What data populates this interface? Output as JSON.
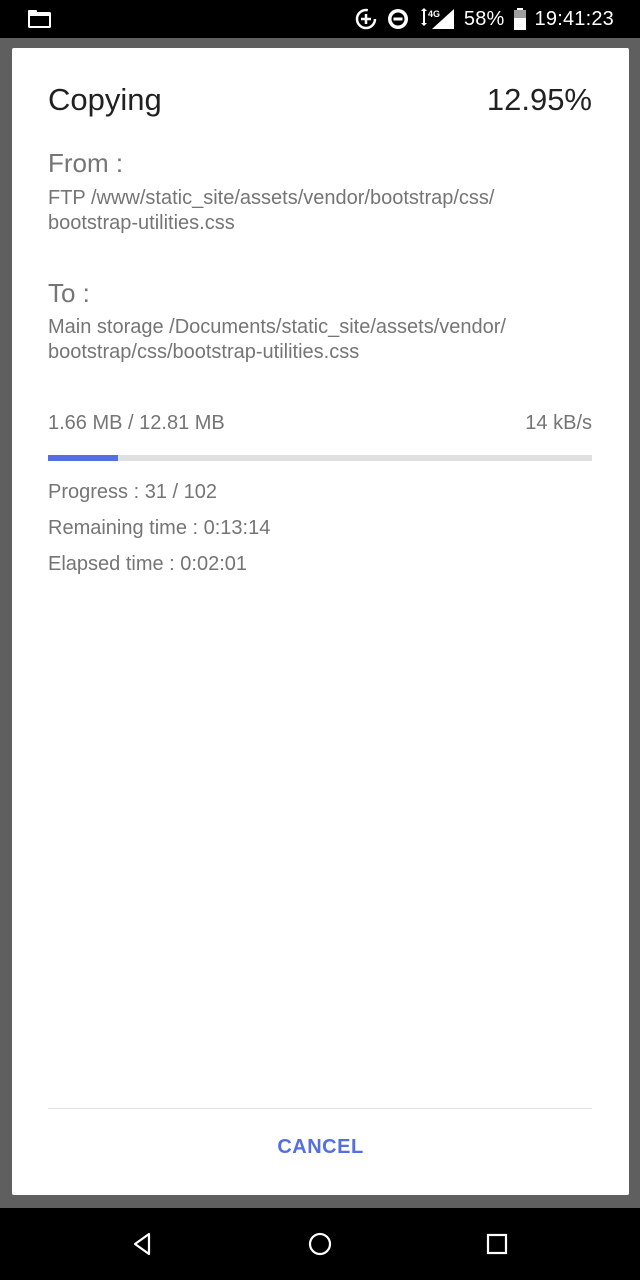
{
  "status_bar": {
    "network": "4G",
    "battery": "58%",
    "time": "19:41:23"
  },
  "dialog": {
    "title": "Copying",
    "percent": "12.95%",
    "from_label": "From :",
    "from_path_line1": "FTP /www/static_site/assets/vendor/bootstrap/css/",
    "from_path_line2": "bootstrap-utilities.css",
    "to_label": "To :",
    "to_path_line1": "Main storage /Documents/static_site/assets/vendor/",
    "to_path_line2": "bootstrap/css/bootstrap-utilities.css",
    "size": "1.66 MB / 12.81 MB",
    "speed": "14 kB/s",
    "progress_fraction": 0.1295,
    "progress": "Progress : 31 / 102",
    "remaining": "Remaining time : 0:13:14",
    "elapsed": "Elapsed time : 0:02:01",
    "cancel_label": "CANCEL"
  },
  "colors": {
    "accent": "#5470e0",
    "track": "#e0e0e0",
    "text_secondary": "#757575",
    "text_primary": "#212121"
  },
  "icons": {
    "status_left": "folder-icon",
    "nav_back": "back-triangle-icon",
    "nav_home": "home-circle-icon",
    "nav_recents": "recents-square-icon"
  }
}
